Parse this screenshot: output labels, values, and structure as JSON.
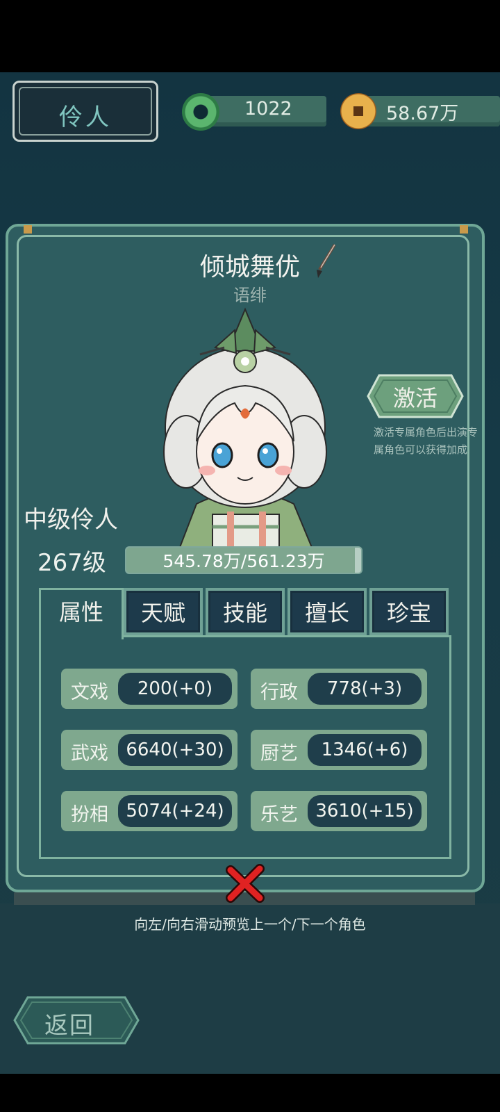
{
  "header": {
    "title": "伶人",
    "jade_count": "1022",
    "coin_amount": "58.67万"
  },
  "character": {
    "title": "倾城舞优",
    "name": "语绯",
    "rank": "中级伶人",
    "level": "267级",
    "exp_text": "545.78万/561.23万",
    "exp_fraction": 0.972
  },
  "activate": {
    "label": "激活",
    "note": "激活专属角色后出演专属角色可以获得加成"
  },
  "tabs": [
    "属性",
    "天赋",
    "技能",
    "擅长",
    "珍宝"
  ],
  "stats": [
    {
      "label": "文戏",
      "value": "200(+0)"
    },
    {
      "label": "行政",
      "value": "778(+3)"
    },
    {
      "label": "武戏",
      "value": "6640(+30)"
    },
    {
      "label": "厨艺",
      "value": "1346(+6)"
    },
    {
      "label": "扮相",
      "value": "5074(+24)"
    },
    {
      "label": "乐艺",
      "value": "3610(+15)"
    }
  ],
  "hint": "向左/向右滑动预览上一个/下一个角色",
  "back_label": "返回"
}
